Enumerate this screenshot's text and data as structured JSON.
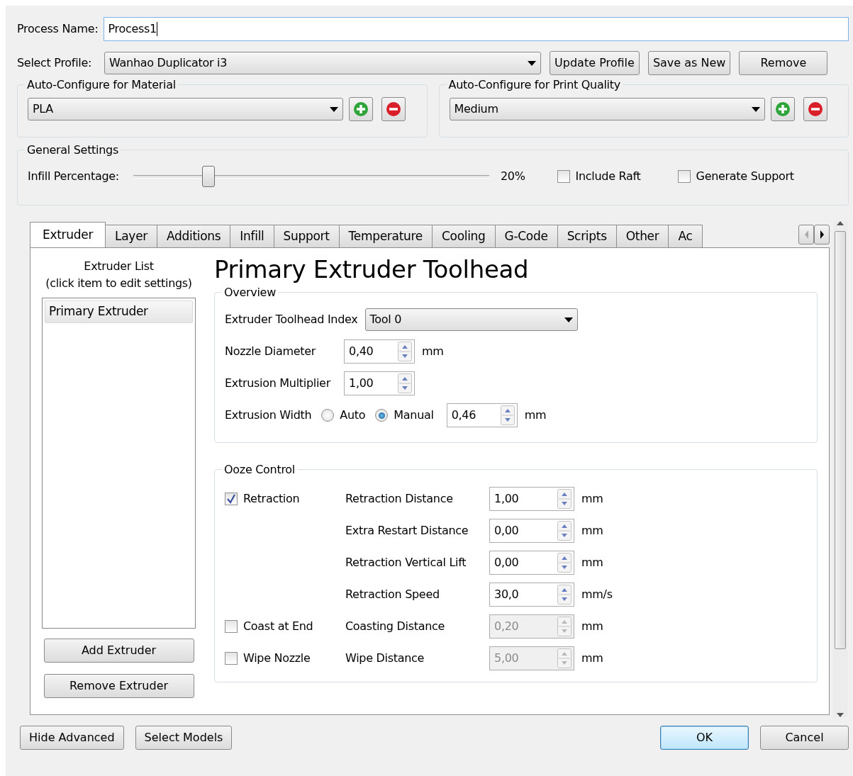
{
  "process_name": {
    "label": "Process Name:",
    "value": "Process1"
  },
  "profile": {
    "label": "Select Profile:",
    "value": "Wanhao Duplicator i3",
    "buttons": [
      "Update Profile",
      "Save as New",
      "Remove"
    ]
  },
  "material": {
    "title": "Auto-Configure for Material",
    "value": "PLA"
  },
  "quality": {
    "title": "Auto-Configure for Print Quality",
    "value": "Medium"
  },
  "general": {
    "title": "General Settings",
    "infill_label": "Infill Percentage:",
    "level": 0.2,
    "reading": "20%",
    "checks": [
      {
        "label": "Include Raft",
        "checked": false
      },
      {
        "label": "Generate Support",
        "checked": false
      }
    ]
  },
  "tabs": [
    {
      "label": "Extruder",
      "selected": true
    },
    {
      "label": "Layer",
      "selected": false
    },
    {
      "label": "Additions",
      "selected": false
    },
    {
      "label": "Infill",
      "selected": false
    },
    {
      "label": "Support",
      "selected": false
    },
    {
      "label": "Temperature",
      "selected": false
    },
    {
      "label": "Cooling",
      "selected": false
    },
    {
      "label": "G-Code",
      "selected": false
    },
    {
      "label": "Scripts",
      "selected": false
    },
    {
      "label": "Other",
      "selected": false
    },
    {
      "label": "Ac",
      "selected": false
    }
  ],
  "extruder_list": {
    "caption": [
      "Extruder List",
      "(click item to edit settings)"
    ],
    "items": [
      {
        "label": "Primary Extruder",
        "selected": true
      }
    ],
    "buttons": [
      "Add Extruder",
      "Remove Extruder"
    ]
  },
  "heading": "Primary Extruder Toolhead",
  "overview": {
    "title": "Overview",
    "toolhead": {
      "label": "Extruder Toolhead Index",
      "value": "Tool 0"
    },
    "nozzle": {
      "label": "Nozzle Diameter",
      "value": "0,40",
      "unit": "mm"
    },
    "multiplier": {
      "label": "Extrusion Multiplier",
      "value": "1,00"
    },
    "width": {
      "label": "Extrusion Width",
      "options": [
        {
          "label": "Auto",
          "selected": false
        },
        {
          "label": "Manual",
          "selected": true
        }
      ],
      "value": "0,46",
      "unit": "mm"
    }
  },
  "ooze": {
    "title": "Ooze Control",
    "rows": [
      {
        "check": {
          "label": "Retraction",
          "checked": true
        },
        "label": "Retraction Distance",
        "value": "1,00",
        "unit": "mm",
        "disabled": false
      },
      {
        "label": "Extra Restart Distance",
        "value": "0,00",
        "unit": "mm",
        "disabled": false
      },
      {
        "label": "Retraction Vertical Lift",
        "value": "0,00",
        "unit": "mm",
        "disabled": false
      },
      {
        "label": "Retraction Speed",
        "value": "30,0",
        "unit": "mm/s",
        "disabled": false
      },
      {
        "check": {
          "label": "Coast at End",
          "checked": false
        },
        "label": "Coasting Distance",
        "value": "0,20",
        "unit": "mm",
        "disabled": true
      },
      {
        "check": {
          "label": "Wipe Nozzle",
          "checked": false
        },
        "label": "Wipe Distance",
        "value": "5,00",
        "unit": "mm",
        "disabled": true
      }
    ]
  },
  "footer": {
    "left": [
      "Hide Advanced",
      "Select Models"
    ],
    "right": [
      {
        "label": "OK",
        "default": true
      },
      {
        "label": "Cancel",
        "default": false
      }
    ]
  }
}
